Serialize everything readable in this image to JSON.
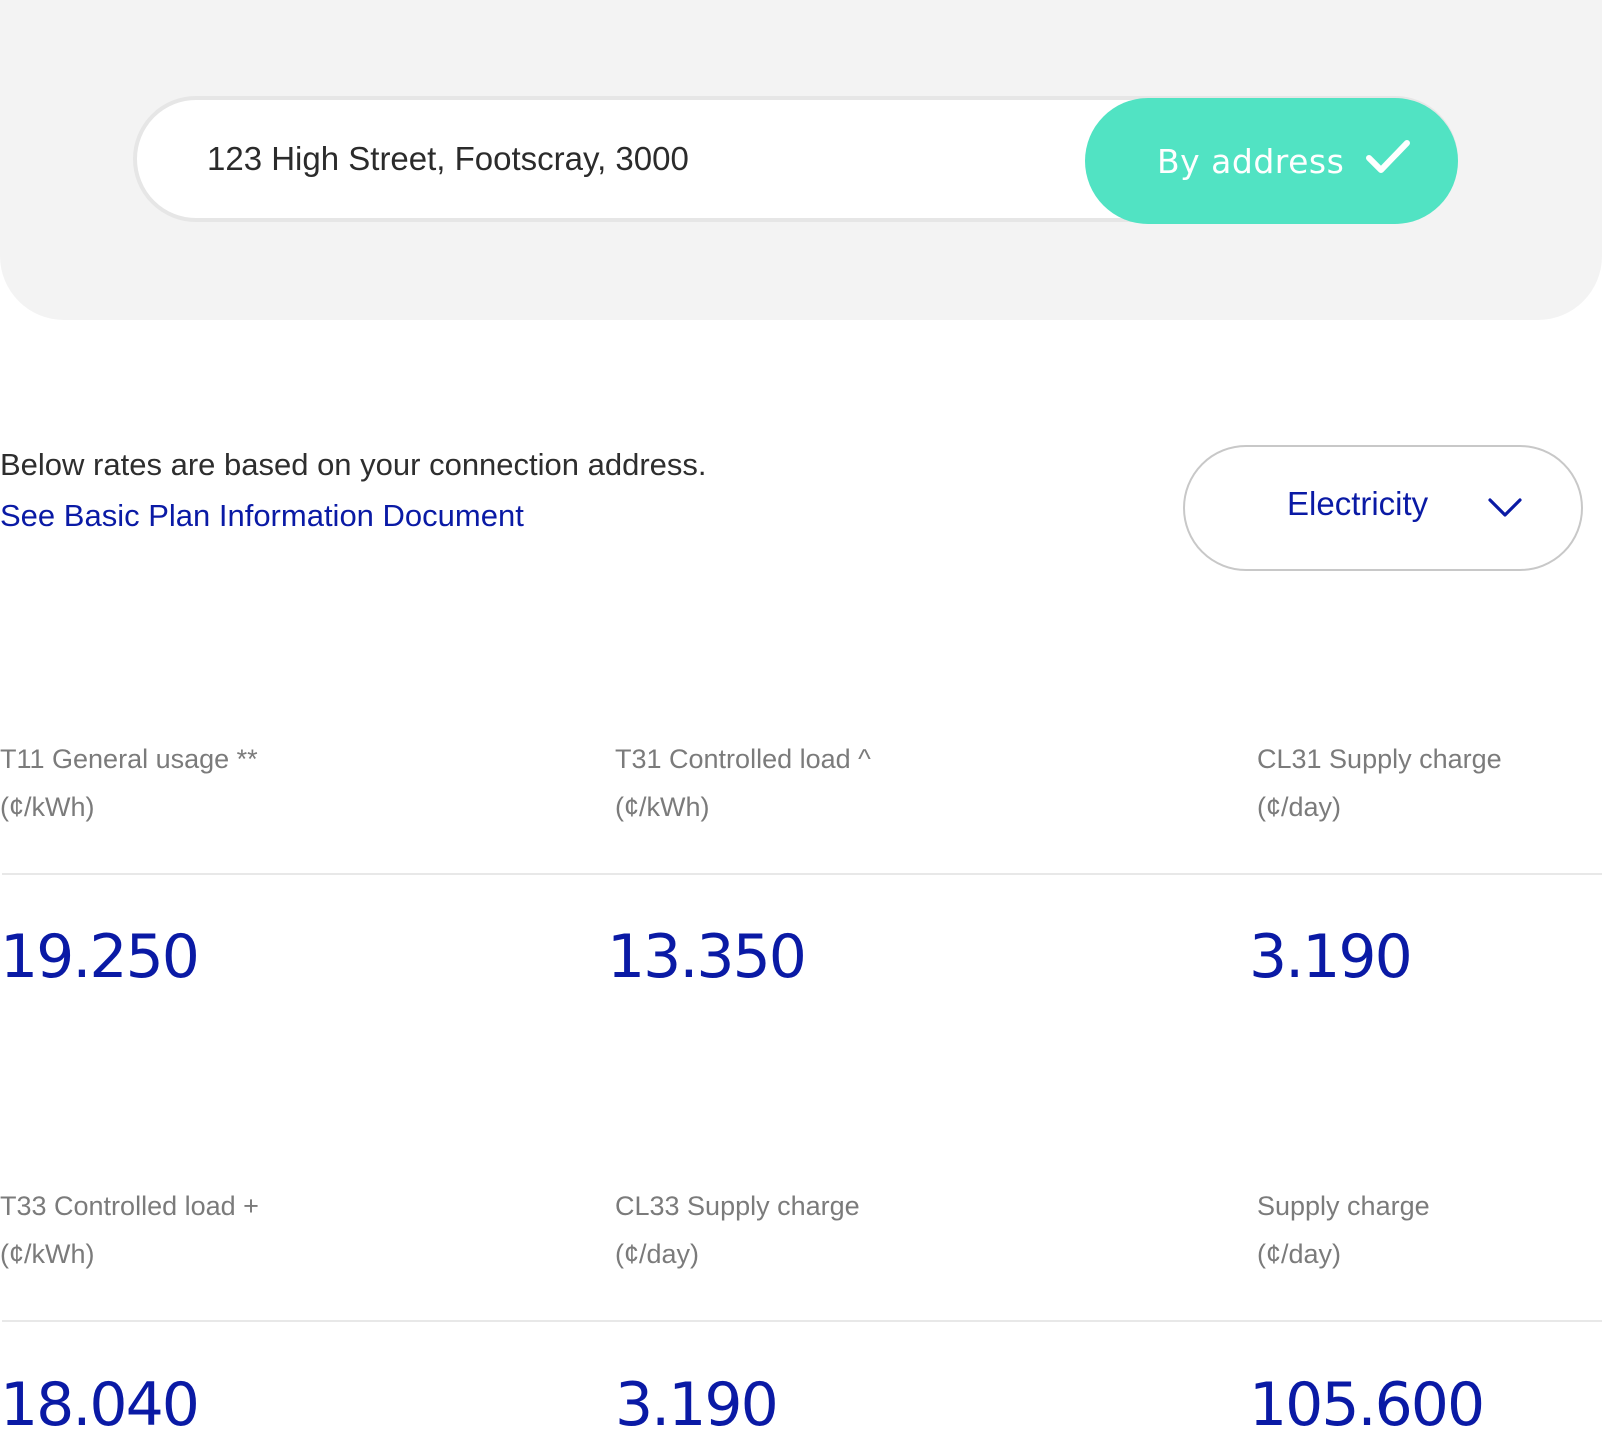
{
  "search": {
    "value": "123 High Street, Footscray, 3000",
    "button_label": "By address",
    "button_icon": "check-icon",
    "accent_color": "#51e3c3"
  },
  "intro": {
    "text": "Below rates are based on your connection address.",
    "link_text": "See Basic Plan Information Document",
    "link_color": "#0a1aa5"
  },
  "fuel_select": {
    "selected": "Electricity",
    "icon": "chevron-down-icon"
  },
  "rates": [
    {
      "name": "T11 General usage **",
      "unit": "(¢/kWh)",
      "value": "19.250"
    },
    {
      "name": "T31 Controlled load ^",
      "unit": "(¢/kWh)",
      "value": "13.350"
    },
    {
      "name": "CL31 Supply charge",
      "unit": "(¢/day)",
      "value": "3.190"
    },
    {
      "name": "T33 Controlled load +",
      "unit": "(¢/kWh)",
      "value": "18.040"
    },
    {
      "name": "CL33 Supply charge",
      "unit": "(¢/day)",
      "value": "3.190"
    },
    {
      "name": "Supply charge",
      "unit": "(¢/day)",
      "value": "105.600"
    }
  ]
}
